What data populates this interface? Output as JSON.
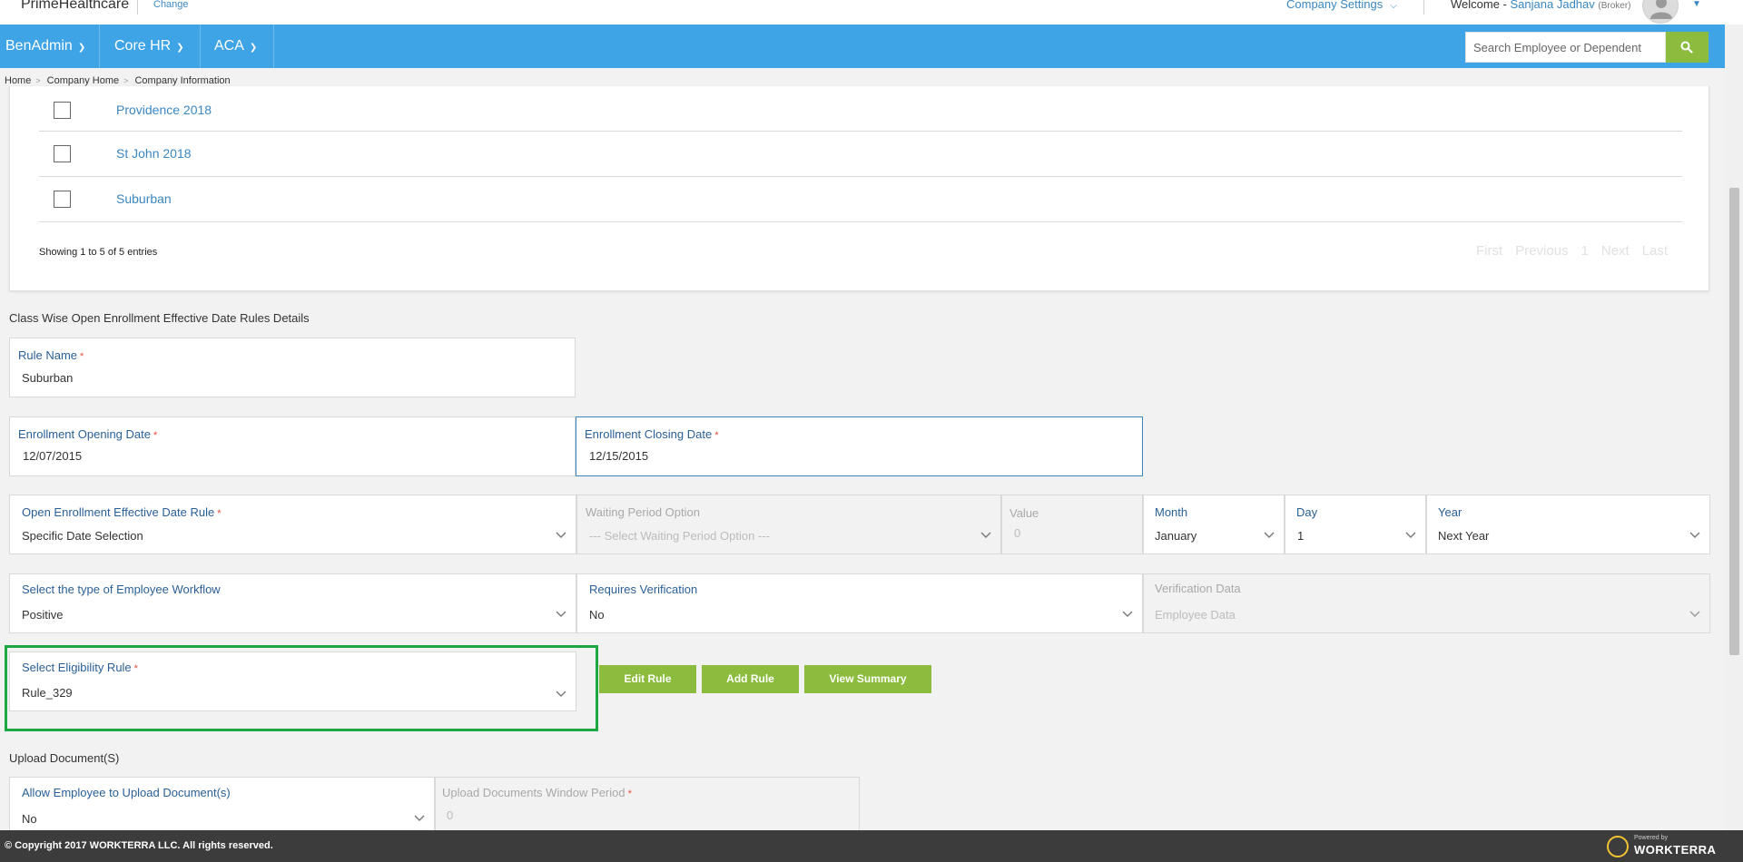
{
  "header": {
    "brand": "PrimeHealthcare",
    "change_link": "Change",
    "company_settings": "Company Settings",
    "welcome_prefix": "Welcome -",
    "user_name": "Sanjana Jadhav",
    "user_role": "(Broker)"
  },
  "nav": {
    "items": [
      {
        "label": "BenAdmin"
      },
      {
        "label": "Core HR"
      },
      {
        "label": "ACA"
      }
    ],
    "search_placeholder": "Search Employee or Dependent"
  },
  "breadcrumb": [
    "Home",
    "Company Home",
    "Company Information"
  ],
  "class_table": {
    "rows": [
      "Providence 2018",
      "St John 2018",
      "Suburban"
    ],
    "showing_text": "Showing 1 to 5 of 5 entries",
    "pager": [
      "First",
      "Previous",
      "1",
      "Next",
      "Last"
    ]
  },
  "section_rules_title": "Class Wise Open Enrollment Effective Date Rules Details",
  "fields": {
    "rule_name": {
      "label": "Rule Name",
      "value": "Suburban"
    },
    "enroll_open": {
      "label": "Enrollment Opening Date",
      "value": "12/07/2015"
    },
    "enroll_close": {
      "label": "Enrollment Closing Date",
      "value": "12/15/2015"
    },
    "oe_rule": {
      "label": "Open Enrollment Effective Date Rule",
      "value": "Specific Date Selection"
    },
    "waiting_period": {
      "label": "Waiting Period Option",
      "value": "--- Select Waiting Period Option ---"
    },
    "value": {
      "label": "Value",
      "value": "0"
    },
    "month": {
      "label": "Month",
      "value": "January"
    },
    "day": {
      "label": "Day",
      "value": "1"
    },
    "year": {
      "label": "Year",
      "value": "Next Year"
    },
    "workflow": {
      "label": "Select the type of Employee Workflow",
      "value": "Positive"
    },
    "requires_verification": {
      "label": "Requires Verification",
      "value": "No"
    },
    "verification_data": {
      "label": "Verification Data",
      "value": "Employee Data"
    },
    "eligibility_rule": {
      "label": "Select Eligibility Rule",
      "value": "Rule_329"
    },
    "allow_upload": {
      "label": "Allow Employee to Upload Document(s)",
      "value": "No"
    },
    "upload_window": {
      "label": "Upload Documents Window Period",
      "value": "0"
    }
  },
  "buttons": {
    "edit_rule": "Edit Rule",
    "add_rule": "Add Rule",
    "view_summary": "View Summary"
  },
  "section_upload_title": "Upload Document(S)",
  "footer": {
    "copyright": "© Copyright 2017 WORKTERRA LLC. All rights reserved.",
    "powered_by": "Powered by",
    "logo_name": "WORKTERRA"
  },
  "colors": {
    "nav_blue": "#3ea4e6",
    "action_green": "#8cbc3d",
    "highlight_green": "#1da744",
    "link_blue": "#3a87c0"
  }
}
